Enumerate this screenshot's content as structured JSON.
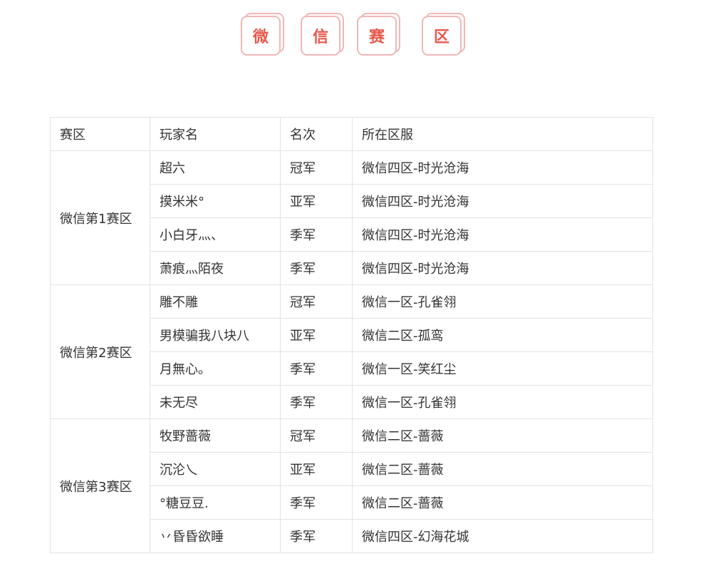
{
  "title": {
    "chars": [
      "微",
      "信",
      "赛",
      "区"
    ]
  },
  "table": {
    "headers": [
      "赛区",
      "玩家名",
      "名次",
      "所在区服"
    ],
    "groups": [
      {
        "division": "微信第1赛区",
        "rows": [
          {
            "player": "超六",
            "rank": "冠军",
            "server": "微信四区-时光沧海"
          },
          {
            "player": "摸米米°",
            "rank": "亚军",
            "server": "微信四区-时光沧海"
          },
          {
            "player": "小白牙灬、",
            "rank": "季军",
            "server": "微信四区-时光沧海"
          },
          {
            "player": "萧痕灬陌夜",
            "rank": "季军",
            "server": "微信四区-时光沧海"
          }
        ]
      },
      {
        "division": "微信第2赛区",
        "rows": [
          {
            "player": "雕不雕",
            "rank": "冠军",
            "server": "微信一区-孔雀翎"
          },
          {
            "player": "男模骗我八块八",
            "rank": "亚军",
            "server": "微信二区-孤鸾"
          },
          {
            "player": "月無心。",
            "rank": "季军",
            "server": "微信一区-笑红尘"
          },
          {
            "player": "未无尽",
            "rank": "季军",
            "server": "微信一区-孔雀翎"
          }
        ]
      },
      {
        "division": "微信第3赛区",
        "rows": [
          {
            "player": "牧野蔷薇",
            "rank": "冠军",
            "server": "微信二区-蔷薇"
          },
          {
            "player": "沉沦乀",
            "rank": "亚军",
            "server": "微信二区-蔷薇"
          },
          {
            "player": "°糖豆豆.",
            "rank": "季军",
            "server": "微信二区-蔷薇"
          },
          {
            "player": "丷昏昏欲睡",
            "rank": "季军",
            "server": "微信四区-幻海花城"
          }
        ]
      }
    ]
  },
  "colors": {
    "title_text": "#e8574c",
    "title_border": "#f1b6b6",
    "table_border": "#e2e2e2",
    "text": "#333333"
  }
}
